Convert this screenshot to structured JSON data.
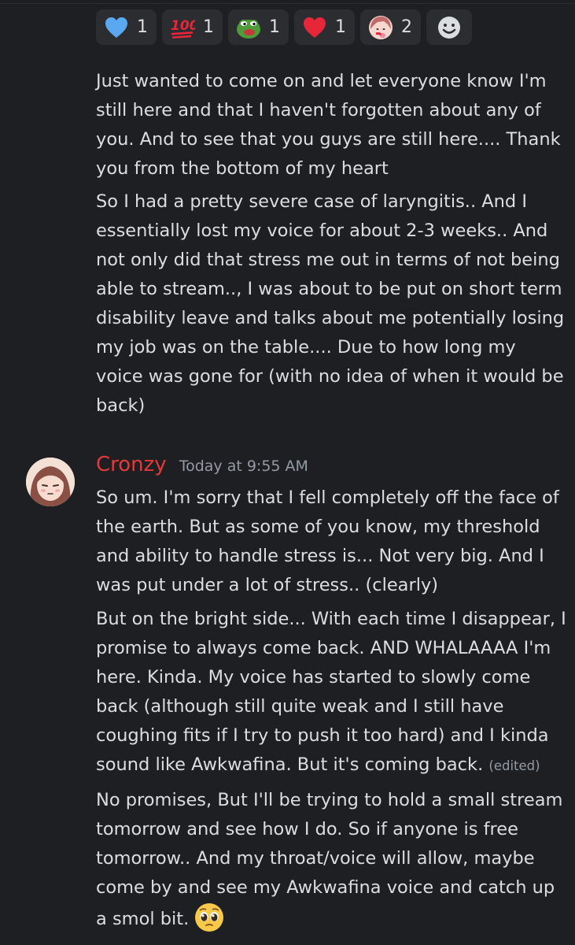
{
  "reactions": [
    {
      "icon": "blue-heart-icon",
      "count": "1"
    },
    {
      "icon": "hundred-points-icon",
      "count": "1"
    },
    {
      "icon": "pepe-frog-icon",
      "count": "1"
    },
    {
      "icon": "red-heart-icon",
      "count": "1"
    },
    {
      "icon": "anime-girl-emote-icon",
      "count": "2"
    }
  ],
  "add_reaction_icon": "add-reaction-icon",
  "messages_before": [
    "Just wanted to come on and let everyone know I'm still here and that I haven't forgotten about any of you. And to see that you guys are still here.... Thank you from the bottom of my heart",
    "So I had a pretty severe case of laryngitis.. And I essentially lost my voice for about 2-3 weeks.. And not only did that stress me out in terms of not being able to stream.., I was about to be put on short term disability leave and talks about me potentially losing my job was on the table.... Due to how long my voice was gone for (with no idea of when it would be back)"
  ],
  "author": {
    "name": "Cronzy",
    "name_color": "#e23a3a",
    "timestamp": "Today at 9:55 AM"
  },
  "messages_after": {
    "m1": "So um. I'm sorry that I fell completely off the face of the earth. But as some of you know, my threshold and ability to handle stress is... Not very big. And I was put under a lot of stress.. (clearly)",
    "m2": "But on the bright side... With each time I disappear, I promise to always come back. AND WHALAAAA I'm here. Kinda. My voice has started to slowly come back (although still quite weak and I still have coughing fits if I try to push it too hard) and I kinda sound like Awkwafina. But it's coming back.",
    "m2_edited": "(edited)",
    "m3": "No promises, But I'll be trying to hold a small stream tomorrow and see how I do. So if anyone is free tomorrow.. And my throat/voice will allow, maybe come by and see my Awkwafina voice and catch up a smol bit.",
    "m3_emoji": "pleading-face-icon"
  },
  "colors": {
    "background": "#1e1f22",
    "text": "#dbdee1",
    "muted": "#949ba4",
    "reaction_bg": "#2b2d31"
  }
}
